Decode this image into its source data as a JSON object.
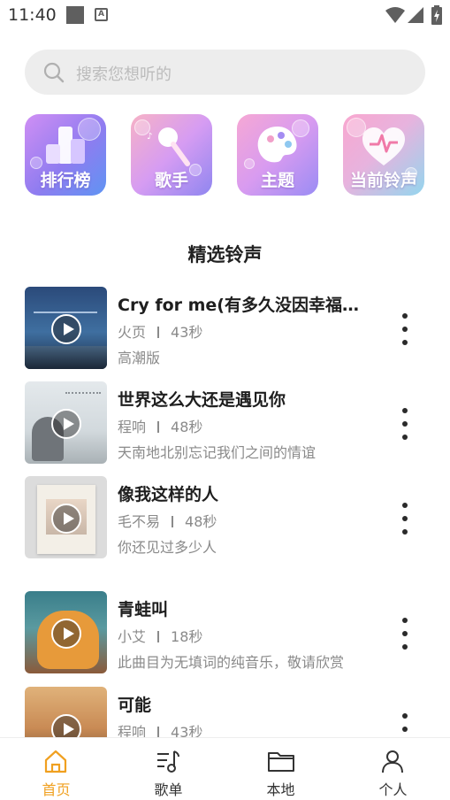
{
  "status_bar": {
    "time": "11:40",
    "icons": [
      "notification-square-icon",
      "a-badge-icon",
      "wifi-icon",
      "signal-icon",
      "battery-charging-icon"
    ]
  },
  "search": {
    "placeholder": "搜索您想听的"
  },
  "categories": [
    {
      "label": "排行榜",
      "icon": "ranking-icon",
      "colors": [
        "#c58bf2",
        "#6c8cf5"
      ]
    },
    {
      "label": "歌手",
      "icon": "microphone-icon",
      "colors": [
        "#f6a0c8",
        "#9b7ef2"
      ]
    },
    {
      "label": "主题",
      "icon": "palette-icon",
      "colors": [
        "#f2a6d6",
        "#9a8cf4"
      ]
    },
    {
      "label": "当前铃声",
      "icon": "heart-pulse-icon",
      "colors": [
        "#fba7cf",
        "#8fd5ef"
      ]
    }
  ],
  "section_title": "精选铃声",
  "songs": [
    {
      "title": "Cry for me(有多久没因幸福流...",
      "artist": "火页",
      "duration": "43秒",
      "desc": "高潮版"
    },
    {
      "title": "世界这么大还是遇见你",
      "artist": "程响",
      "duration": "48秒",
      "desc": "天南地北别忘记我们之间的情谊"
    },
    {
      "title": "像我这样的人",
      "artist": "毛不易",
      "duration": "48秒",
      "desc": "你还见过多少人"
    },
    {
      "title": "青蛙叫",
      "artist": "小艾",
      "duration": "18秒",
      "desc": "此曲目为无填词的纯音乐，敬请欣赏"
    },
    {
      "title": "可能",
      "artist": "程响",
      "duration": "43秒",
      "desc": ""
    }
  ],
  "bottom_nav": [
    {
      "label": "首页",
      "icon": "home-icon",
      "active": true
    },
    {
      "label": "歌单",
      "icon": "playlist-icon",
      "active": false
    },
    {
      "label": "本地",
      "icon": "folder-icon",
      "active": false
    },
    {
      "label": "个人",
      "icon": "person-icon",
      "active": false
    }
  ],
  "accent_color": "#f0a020"
}
